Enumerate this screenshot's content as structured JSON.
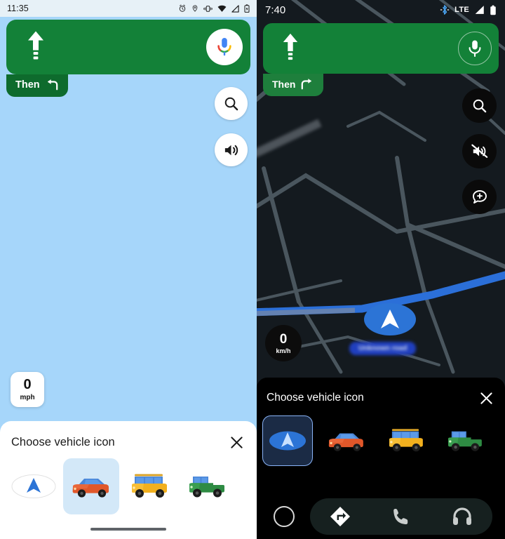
{
  "left_panel": {
    "theme": "light",
    "status_bar": {
      "time": "11:35",
      "icons": [
        "alarm-icon",
        "location-icon",
        "vibrate-icon",
        "wifi-icon",
        "signal-icon",
        "battery-icon"
      ]
    },
    "navigation_card": {
      "maneuver_icon": "straight-ahead-arrow-icon",
      "mic_icon": "google-assistant-mic-icon",
      "background_color": "#138138"
    },
    "then_badge": {
      "label": "Then",
      "turn_icon": "turn-left-icon",
      "background_color": "#0E6B2D"
    },
    "map_controls": [
      {
        "name": "search-button",
        "icon": "search-icon"
      },
      {
        "name": "volume-button",
        "icon": "volume-on-icon"
      }
    ],
    "speedometer": {
      "value": "0",
      "unit": "mph"
    },
    "map_background_color": "#A6D6FA",
    "bottom_sheet": {
      "title": "Choose vehicle icon",
      "close_icon": "close-icon",
      "selected_index": 1,
      "vehicles": [
        {
          "name": "default-arrow",
          "icon": "navigation-arrow-icon"
        },
        {
          "name": "orange-sedan",
          "icon": "car-sedan-icon"
        },
        {
          "name": "yellow-suv",
          "icon": "car-suv-icon"
        },
        {
          "name": "green-pickup",
          "icon": "car-pickup-icon"
        }
      ],
      "home_indicator": true
    }
  },
  "right_panel": {
    "theme": "dark",
    "status_bar": {
      "time": "7:40",
      "network_label": "LTE",
      "icons": [
        "bluetooth-icon",
        "signal-icon",
        "battery-icon"
      ]
    },
    "navigation_card": {
      "maneuver_icon": "straight-ahead-arrow-icon",
      "mic_icon": "mic-icon",
      "background_color": "#138138"
    },
    "then_badge": {
      "label": "Then",
      "turn_icon": "turn-right-icon",
      "background_color": "#1E7F3C"
    },
    "map_controls": [
      {
        "name": "search-button",
        "icon": "search-icon"
      },
      {
        "name": "volume-button",
        "icon": "volume-muted-icon"
      },
      {
        "name": "report-button",
        "icon": "add-report-icon"
      }
    ],
    "speedometer": {
      "value": "0",
      "unit": "km/h"
    },
    "vehicle_puck": {
      "icon": "navigation-arrow-icon",
      "color": "#2C74D6"
    },
    "road_label": "Unknown road",
    "map_background_color": "#141A1F",
    "bottom_sheet": {
      "title": "Choose vehicle icon",
      "close_icon": "close-icon",
      "selected_index": 0,
      "vehicles": [
        {
          "name": "default-arrow",
          "icon": "navigation-arrow-icon"
        },
        {
          "name": "orange-sedan",
          "icon": "car-sedan-icon"
        },
        {
          "name": "yellow-suv",
          "icon": "car-suv-icon"
        },
        {
          "name": "green-pickup",
          "icon": "car-pickup-icon"
        }
      ]
    },
    "nav_bar": {
      "home_icon": "home-circle-icon",
      "items": [
        {
          "name": "navigation-tab",
          "icon": "navigation-diamond-icon"
        },
        {
          "name": "phone-tab",
          "icon": "phone-icon"
        },
        {
          "name": "media-tab",
          "icon": "headphones-icon"
        }
      ]
    }
  }
}
